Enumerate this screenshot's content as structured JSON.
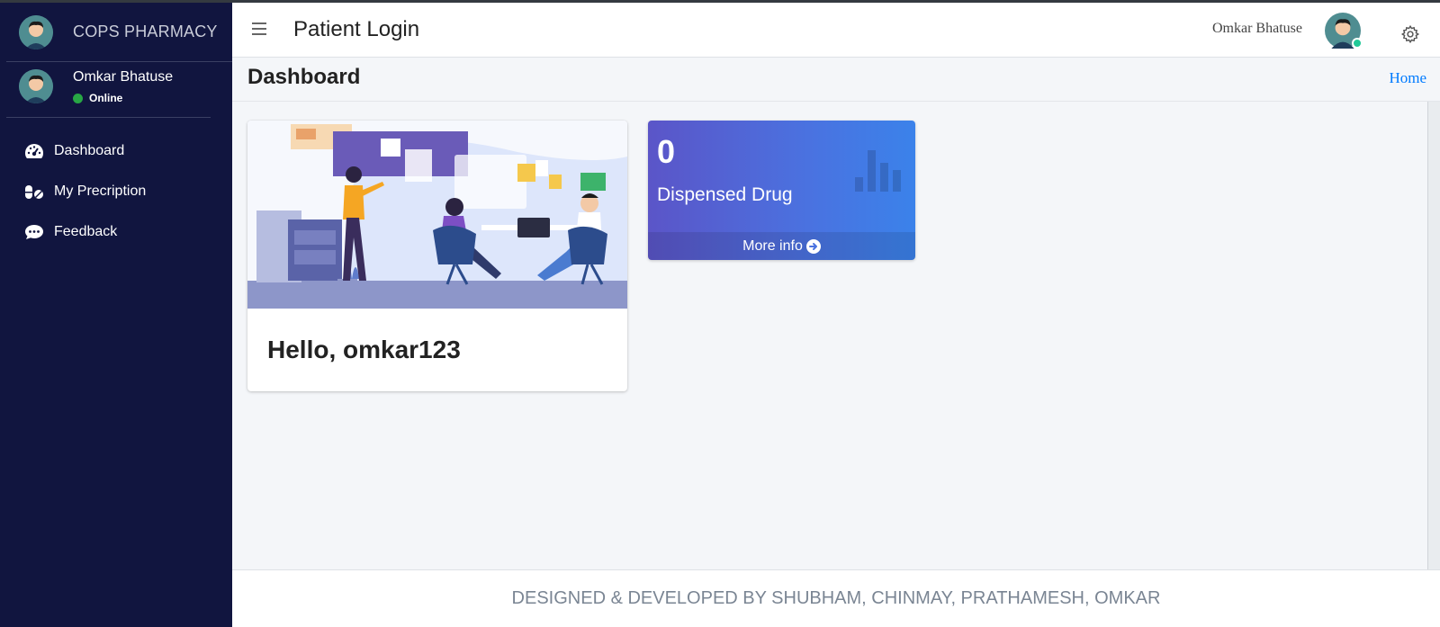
{
  "brand": {
    "name": "COPS PHARMACY"
  },
  "sidebar": {
    "user": {
      "name": "Omkar Bhatuse",
      "status": "Online"
    },
    "items": [
      {
        "label": "Dashboard",
        "icon": "tachometer-icon"
      },
      {
        "label": "My Precription",
        "icon": "pills-icon"
      },
      {
        "label": "Feedback",
        "icon": "comment-dots-icon"
      }
    ]
  },
  "header": {
    "title": "Patient Login",
    "user_name": "Omkar Bhatuse"
  },
  "content": {
    "page_title": "Dashboard",
    "breadcrumb": "Home",
    "welcome": "Hello, omkar123",
    "stat": {
      "value": "0",
      "label": "Dispensed Drug",
      "more_info": "More info"
    }
  },
  "footer": {
    "text": "DESIGNED & DEVELOPED BY SHUBHAM, CHINMAY, PRATHAMESH, OMKAR"
  },
  "colors": {
    "sidebar_bg": "#11153f",
    "accent": "#007bff",
    "status_online": "#28a745",
    "stat_gradient_start": "#5b55c8",
    "stat_gradient_end": "#3b82ea"
  }
}
